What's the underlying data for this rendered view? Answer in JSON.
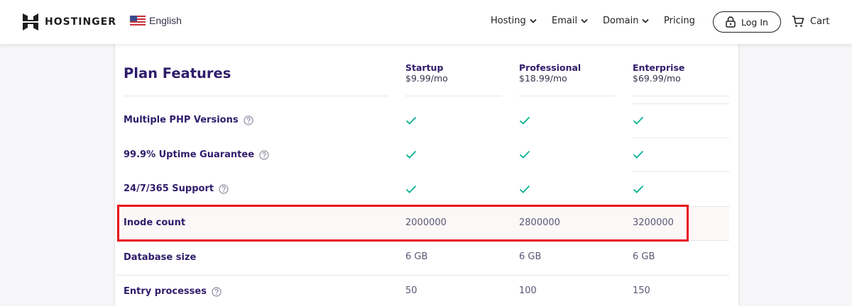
{
  "header": {
    "brand": "HOSTINGER",
    "language": "English",
    "nav": [
      {
        "label": "Hosting"
      },
      {
        "label": "Email"
      },
      {
        "label": "Domain"
      },
      {
        "label": "Pricing"
      }
    ],
    "login_label": "Log In",
    "cart_label": "Cart"
  },
  "table": {
    "title": "Plan Features",
    "plans": [
      {
        "name": "Startup",
        "price": "$9.99/mo"
      },
      {
        "name": "Professional",
        "price": "$18.99/mo"
      },
      {
        "name": "Enterprise",
        "price": "$69.99/mo"
      }
    ],
    "rows": [
      {
        "label": "Multiple PHP Versions",
        "help": true,
        "values": [
          "check",
          "check",
          "check"
        ]
      },
      {
        "label": "99.9% Uptime Guarantee",
        "help": true,
        "values": [
          "check",
          "check",
          "check"
        ]
      },
      {
        "label": "24/7/365 Support",
        "help": true,
        "values": [
          "check",
          "check",
          "check"
        ]
      },
      {
        "label": "Inode count",
        "help": false,
        "values": [
          "2000000",
          "2800000",
          "3200000"
        ]
      },
      {
        "label": "Database size",
        "help": false,
        "values": [
          "6 GB",
          "6 GB",
          "6 GB"
        ]
      },
      {
        "label": "Entry processes",
        "help": true,
        "values": [
          "50",
          "100",
          "150"
        ]
      }
    ]
  },
  "colors": {
    "accent": "#2f1c6a",
    "check": "#00b090",
    "highlight": "#e8111b"
  }
}
